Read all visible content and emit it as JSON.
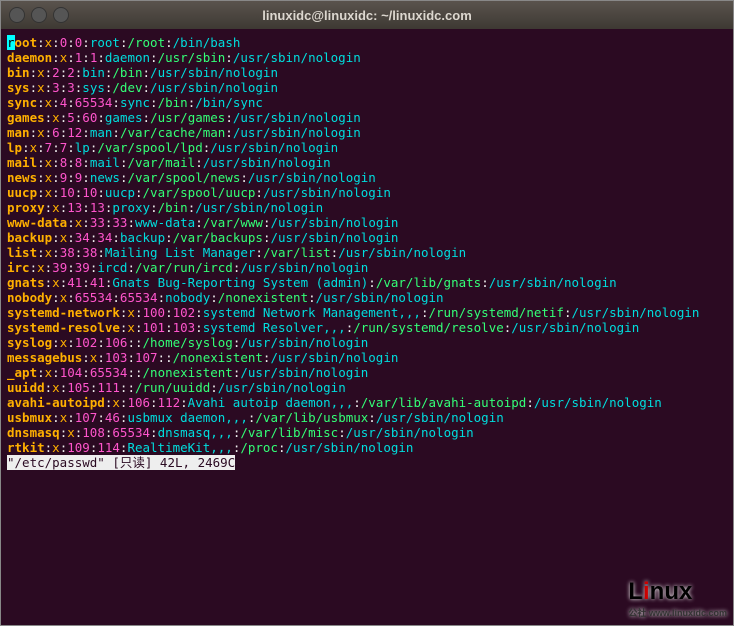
{
  "window": {
    "title": "linuxidc@linuxidc: ~/linuxidc.com"
  },
  "status": "\"/etc/passwd\" [只读] 42L, 2469C",
  "watermark": {
    "brand_pre": "L",
    "brand_i": "i",
    "brand_post": "nux",
    "sub": "公社\nwww.linuxidc.com"
  },
  "entries": [
    {
      "user": "root",
      "pwd": "x",
      "uid": "0",
      "gid": "0",
      "name": "root",
      "home": "/root",
      "shell": "/bin/bash"
    },
    {
      "user": "daemon",
      "pwd": "x",
      "uid": "1",
      "gid": "1",
      "name": "daemon",
      "home": "/usr/sbin",
      "shell": "/usr/sbin/nologin"
    },
    {
      "user": "bin",
      "pwd": "x",
      "uid": "2",
      "gid": "2",
      "name": "bin",
      "home": "/bin",
      "shell": "/usr/sbin/nologin"
    },
    {
      "user": "sys",
      "pwd": "x",
      "uid": "3",
      "gid": "3",
      "name": "sys",
      "home": "/dev",
      "shell": "/usr/sbin/nologin"
    },
    {
      "user": "sync",
      "pwd": "x",
      "uid": "4",
      "gid": "65534",
      "name": "sync",
      "home": "/bin",
      "shell": "/bin/sync"
    },
    {
      "user": "games",
      "pwd": "x",
      "uid": "5",
      "gid": "60",
      "name": "games",
      "home": "/usr/games",
      "shell": "/usr/sbin/nologin"
    },
    {
      "user": "man",
      "pwd": "x",
      "uid": "6",
      "gid": "12",
      "name": "man",
      "home": "/var/cache/man",
      "shell": "/usr/sbin/nologin"
    },
    {
      "user": "lp",
      "pwd": "x",
      "uid": "7",
      "gid": "7",
      "name": "lp",
      "home": "/var/spool/lpd",
      "shell": "/usr/sbin/nologin"
    },
    {
      "user": "mail",
      "pwd": "x",
      "uid": "8",
      "gid": "8",
      "name": "mail",
      "home": "/var/mail",
      "shell": "/usr/sbin/nologin"
    },
    {
      "user": "news",
      "pwd": "x",
      "uid": "9",
      "gid": "9",
      "name": "news",
      "home": "/var/spool/news",
      "shell": "/usr/sbin/nologin"
    },
    {
      "user": "uucp",
      "pwd": "x",
      "uid": "10",
      "gid": "10",
      "name": "uucp",
      "home": "/var/spool/uucp",
      "shell": "/usr/sbin/nologin"
    },
    {
      "user": "proxy",
      "pwd": "x",
      "uid": "13",
      "gid": "13",
      "name": "proxy",
      "home": "/bin",
      "shell": "/usr/sbin/nologin"
    },
    {
      "user": "www-data",
      "pwd": "x",
      "uid": "33",
      "gid": "33",
      "name": "www-data",
      "home": "/var/www",
      "shell": "/usr/sbin/nologin"
    },
    {
      "user": "backup",
      "pwd": "x",
      "uid": "34",
      "gid": "34",
      "name": "backup",
      "home": "/var/backups",
      "shell": "/usr/sbin/nologin"
    },
    {
      "user": "list",
      "pwd": "x",
      "uid": "38",
      "gid": "38",
      "name": "Mailing List Manager",
      "home": "/var/list",
      "shell": "/usr/sbin/nologin"
    },
    {
      "user": "irc",
      "pwd": "x",
      "uid": "39",
      "gid": "39",
      "name": "ircd",
      "home": "/var/run/ircd",
      "shell": "/usr/sbin/nologin"
    },
    {
      "user": "gnats",
      "pwd": "x",
      "uid": "41",
      "gid": "41",
      "name": "Gnats Bug-Reporting System (admin)",
      "home": "/var/lib/gnats",
      "shell": "/usr/sbin/nologin"
    },
    {
      "user": "nobody",
      "pwd": "x",
      "uid": "65534",
      "gid": "65534",
      "name": "nobody",
      "home": "/nonexistent",
      "shell": "/usr/sbin/nologin"
    },
    {
      "user": "systemd-network",
      "pwd": "x",
      "uid": "100",
      "gid": "102",
      "name": "systemd Network Management,,,",
      "home": "/run/systemd/netif",
      "shell": "/usr/sbin/nologin"
    },
    {
      "user": "systemd-resolve",
      "pwd": "x",
      "uid": "101",
      "gid": "103",
      "name": "systemd Resolver,,,",
      "home": "/run/systemd/resolve",
      "shell": "/usr/sbin/nologin"
    },
    {
      "user": "syslog",
      "pwd": "x",
      "uid": "102",
      "gid": "106",
      "name": "",
      "home": "/home/syslog",
      "shell": "/usr/sbin/nologin"
    },
    {
      "user": "messagebus",
      "pwd": "x",
      "uid": "103",
      "gid": "107",
      "name": "",
      "home": "/nonexistent",
      "shell": "/usr/sbin/nologin"
    },
    {
      "user": "_apt",
      "pwd": "x",
      "uid": "104",
      "gid": "65534",
      "name": "",
      "home": "/nonexistent",
      "shell": "/usr/sbin/nologin"
    },
    {
      "user": "uuidd",
      "pwd": "x",
      "uid": "105",
      "gid": "111",
      "name": "",
      "home": "/run/uuidd",
      "shell": "/usr/sbin/nologin"
    },
    {
      "user": "avahi-autoipd",
      "pwd": "x",
      "uid": "106",
      "gid": "112",
      "name": "Avahi autoip daemon,,,",
      "home": "/var/lib/avahi-autoipd",
      "shell": "/usr/sbin/nologin"
    },
    {
      "user": "usbmux",
      "pwd": "x",
      "uid": "107",
      "gid": "46",
      "name": "usbmux daemon,,,",
      "home": "/var/lib/usbmux",
      "shell": "/usr/sbin/nologin"
    },
    {
      "user": "dnsmasq",
      "pwd": "x",
      "uid": "108",
      "gid": "65534",
      "name": "dnsmasq,,,",
      "home": "/var/lib/misc",
      "shell": "/usr/sbin/nologin"
    },
    {
      "user": "rtkit",
      "pwd": "x",
      "uid": "109",
      "gid": "114",
      "name": "RealtimeKit,,,",
      "home": "/proc",
      "shell": "/usr/sbin/nologin"
    }
  ]
}
